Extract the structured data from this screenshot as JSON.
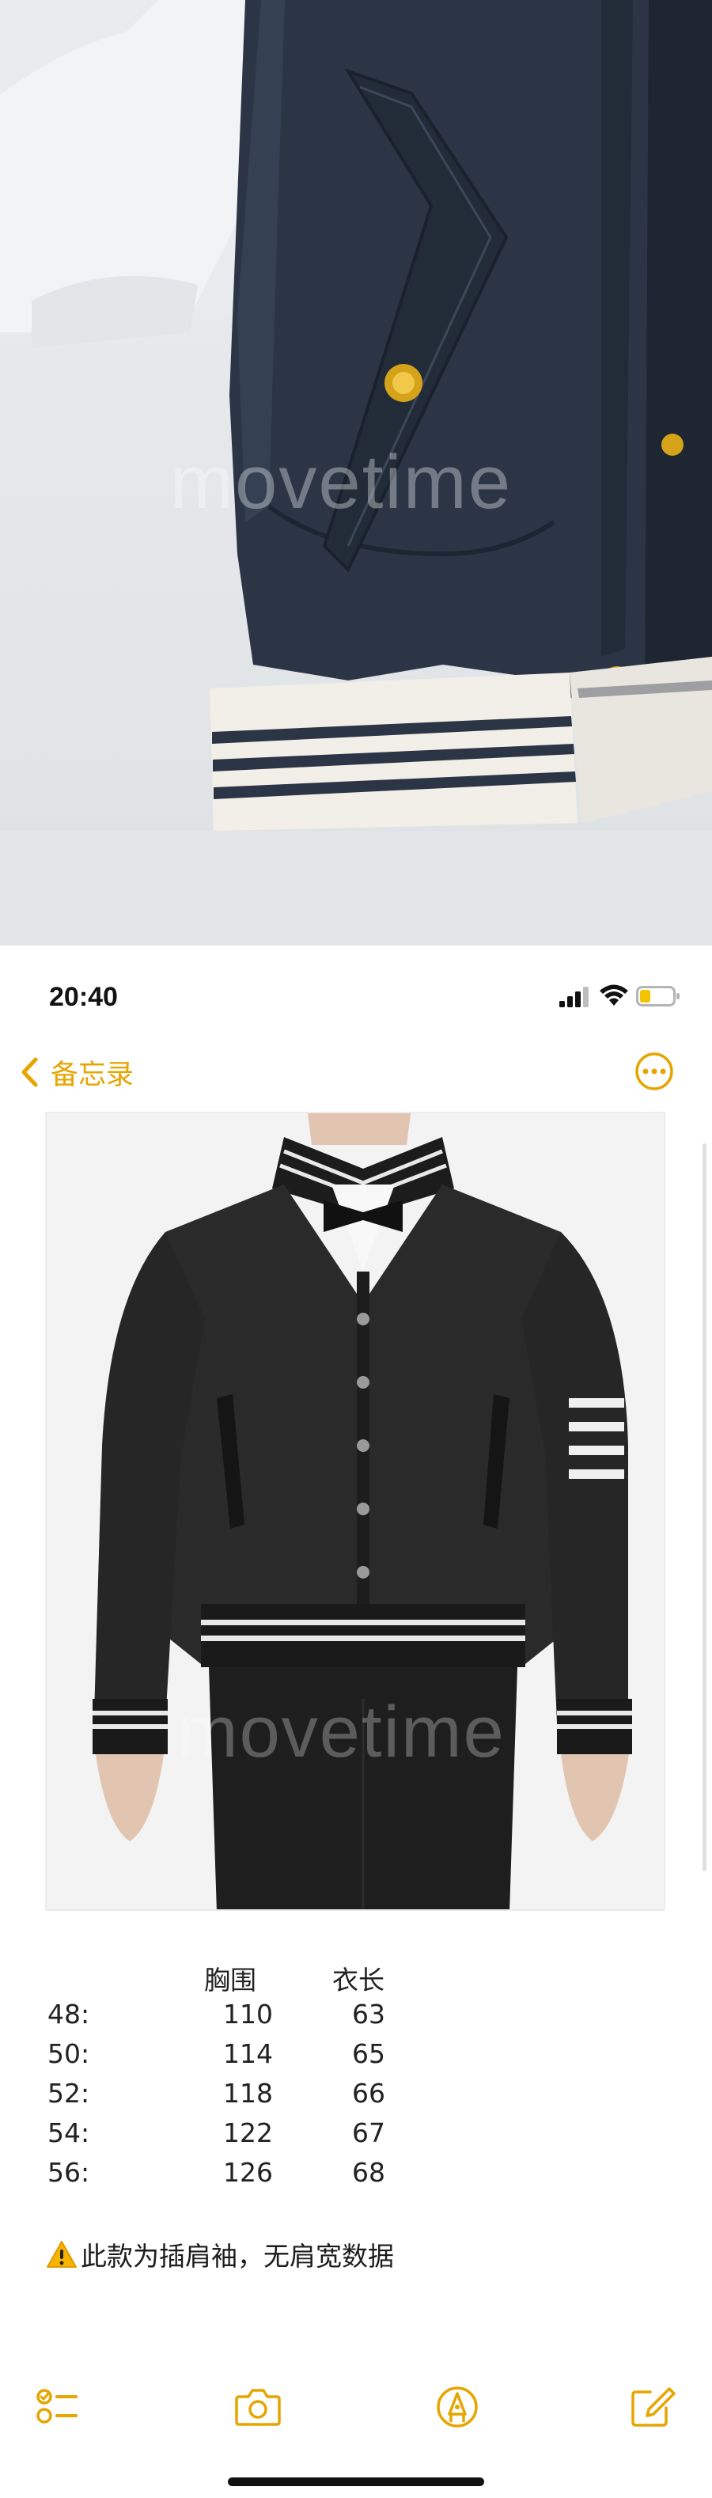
{
  "watermark_top": "movetime",
  "watermark_bottom": "movetime",
  "status_bar": {
    "time": "20:40"
  },
  "nav": {
    "back_label": "备忘录",
    "accent_color": "#e6a500"
  },
  "size_table": {
    "headers": [
      "",
      "胸围",
      "衣长"
    ],
    "rows": [
      {
        "size": "48:",
        "chest": "110",
        "length": "63"
      },
      {
        "size": "50:",
        "chest": "114",
        "length": "65"
      },
      {
        "size": "52:",
        "chest": "118",
        "length": "66"
      },
      {
        "size": "54:",
        "chest": "122",
        "length": "67"
      },
      {
        "size": "56:",
        "chest": "126",
        "length": "68"
      }
    ]
  },
  "note_text": "此款为插肩袖，无肩宽数据",
  "icons": {
    "warning": "warning-icon",
    "checklist": "checklist-icon",
    "camera": "camera-icon",
    "markup": "markup-pen-icon",
    "compose": "compose-icon",
    "more": "more-options-icon",
    "back": "chevron-left-icon"
  }
}
